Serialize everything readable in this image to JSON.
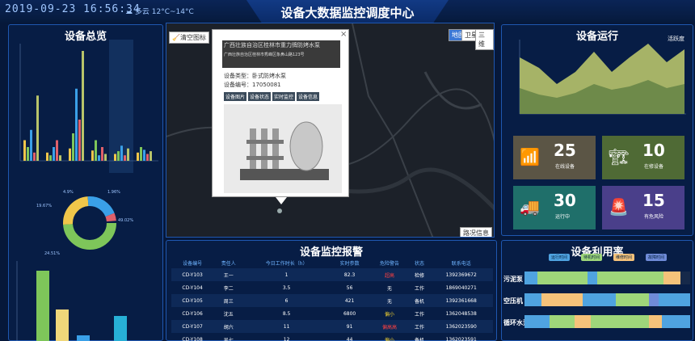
{
  "header": {
    "datetime": "2019-09-23  16:56:34",
    "weather": "多云 12°C~14°C",
    "title": "设备大数据监控调度中心"
  },
  "overview": {
    "title": "设备总览"
  },
  "map": {
    "clear_button": "清空图标",
    "view_tabs": [
      "地图",
      "卫星",
      "三维"
    ],
    "traffic_button": "路况信息",
    "popup": {
      "title": "广西壮族自治区桂林市重力牌防烤水泵",
      "address": "广西壮族自治区桂林市秀峰区象鼻山路123号",
      "type_label": "设备类型：卧式防烤水泵",
      "id_label": "设备编号：17050081",
      "tabs": [
        "设备图片",
        "设备状态",
        "实时监控",
        "设备信息"
      ],
      "close": "×"
    }
  },
  "operation": {
    "title": "设备运行",
    "legend": "活跃度"
  },
  "stats": [
    {
      "value": "25",
      "label": "在线设备",
      "color": "#5b5545"
    },
    {
      "value": "10",
      "label": "在修设备",
      "color": "#4f6a35"
    },
    {
      "value": "30",
      "label": "运行中",
      "color": "#1f6f6a"
    },
    {
      "value": "15",
      "label": "有危风险",
      "color": "#4a3f8a"
    }
  ],
  "alarm": {
    "title": "设备监控报警",
    "columns": [
      "设备编号",
      "责任人",
      "今日工作时长（h）",
      "实时参数",
      "危险警告",
      "状态",
      "联系电话"
    ],
    "rows": [
      [
        "CD-Y103",
        "王一",
        "1",
        "82.3",
        "超高",
        "检修",
        "1392369672"
      ],
      [
        "CD-Y104",
        "李二",
        "3.5",
        "56",
        "无",
        "工作",
        "1869040271"
      ],
      [
        "CD-Y105",
        "周三",
        "6",
        "421",
        "无",
        "备机",
        "1392361668"
      ],
      [
        "CD-Y106",
        "沈五",
        "8.5",
        "6800",
        "偏小",
        "工作",
        "1362048538"
      ],
      [
        "CD-Y107",
        "胡六",
        "11",
        "91",
        "偏高高",
        "工作",
        "1362023590"
      ],
      [
        "CD-Y108",
        "吴七",
        "12",
        "44",
        "偏小",
        "备机",
        "1362023591"
      ]
    ]
  },
  "utilization": {
    "title": "设备利用率",
    "legend": [
      "运行时间",
      "待机时间",
      "维修时间",
      "故障时间"
    ],
    "rows": [
      "污泥泵",
      "空压机",
      "循环水泵"
    ]
  },
  "donut": {
    "labels": [
      "4.9%",
      "1.96%",
      "19.67%",
      "49.02%",
      "24.51%"
    ]
  }
}
